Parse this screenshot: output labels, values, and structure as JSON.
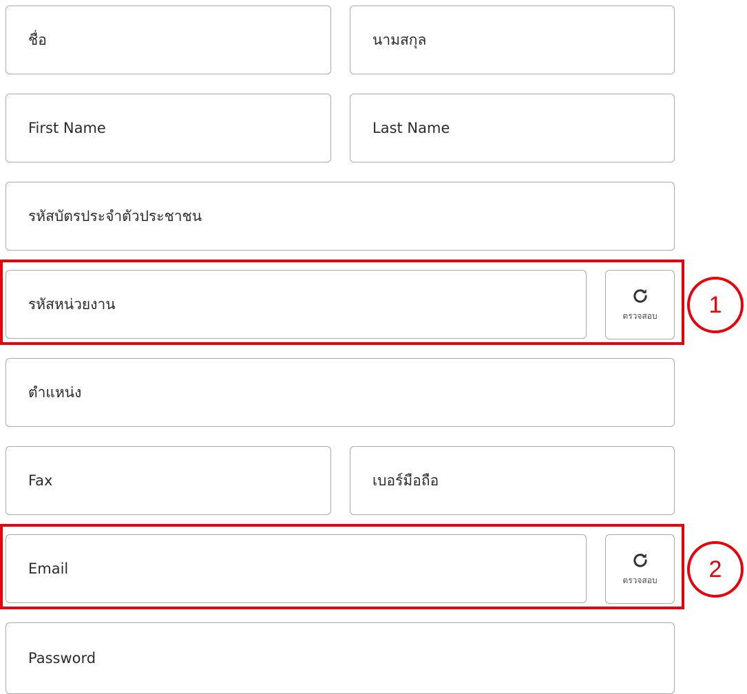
{
  "form": {
    "first_name_th": "ชื่อ",
    "last_name_th": "นามสกุล",
    "first_name_en": "First Name",
    "last_name_en": "Last Name",
    "citizen_id": "รหัสบัตรประจำตัวประชาชน",
    "unit_code": "รหัสหน่วยงาน",
    "position": "ตำแหน่ง",
    "fax": "Fax",
    "mobile": "เบอร์มือถือ",
    "email": "Email",
    "password": "Password"
  },
  "check_button": {
    "label": "ตรวจสอบ",
    "icon": "refresh-icon"
  },
  "annotations": {
    "callout_1": "1",
    "callout_2": "2",
    "color": "#e8000b"
  }
}
